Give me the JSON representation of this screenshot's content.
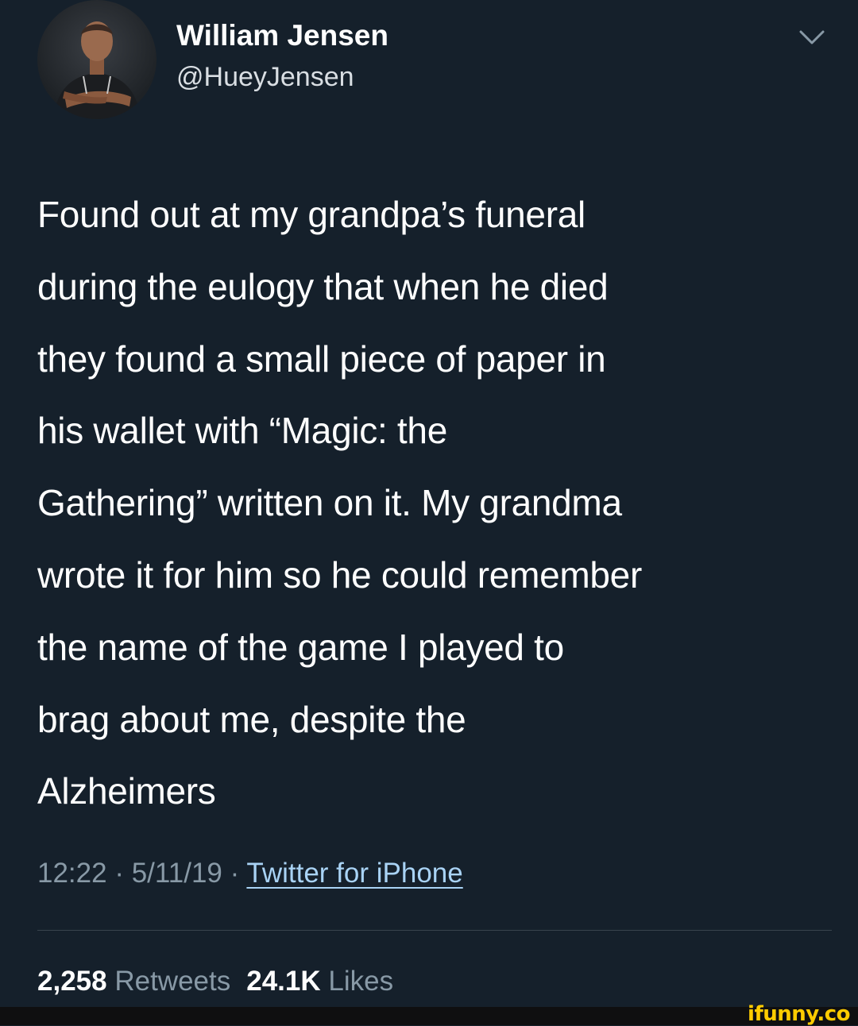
{
  "tweet": {
    "author": {
      "display_name": "William Jensen",
      "handle": "@HueyJensen"
    },
    "text_lines": [
      "Found out at my grandpa’s funeral",
      "during the eulogy that when he died",
      "they found a small piece of paper in",
      "his wallet with “Magic: the",
      "Gathering” written on it. My grandma",
      "wrote it for him so he could remember",
      "the name of the game I played to",
      "brag about me, despite the",
      "Alzheimers"
    ],
    "time": "12:22",
    "date": "5/11/19",
    "separator": "·",
    "source": "Twitter for iPhone",
    "stats": {
      "retweets_count": "2,258",
      "retweets_label": "Retweets",
      "likes_count": "24.1K",
      "likes_label": "Likes"
    },
    "icons": {
      "menu": "chevron-down-icon",
      "avatar": "avatar"
    }
  },
  "watermark": {
    "text": "ifunny.co",
    "color": "#ffcc00"
  },
  "colors": {
    "background": "#15202b",
    "primary_text": "#ffffff",
    "secondary_text": "#8899a6",
    "link": "#a9d3f5",
    "divider": "#38444d"
  }
}
